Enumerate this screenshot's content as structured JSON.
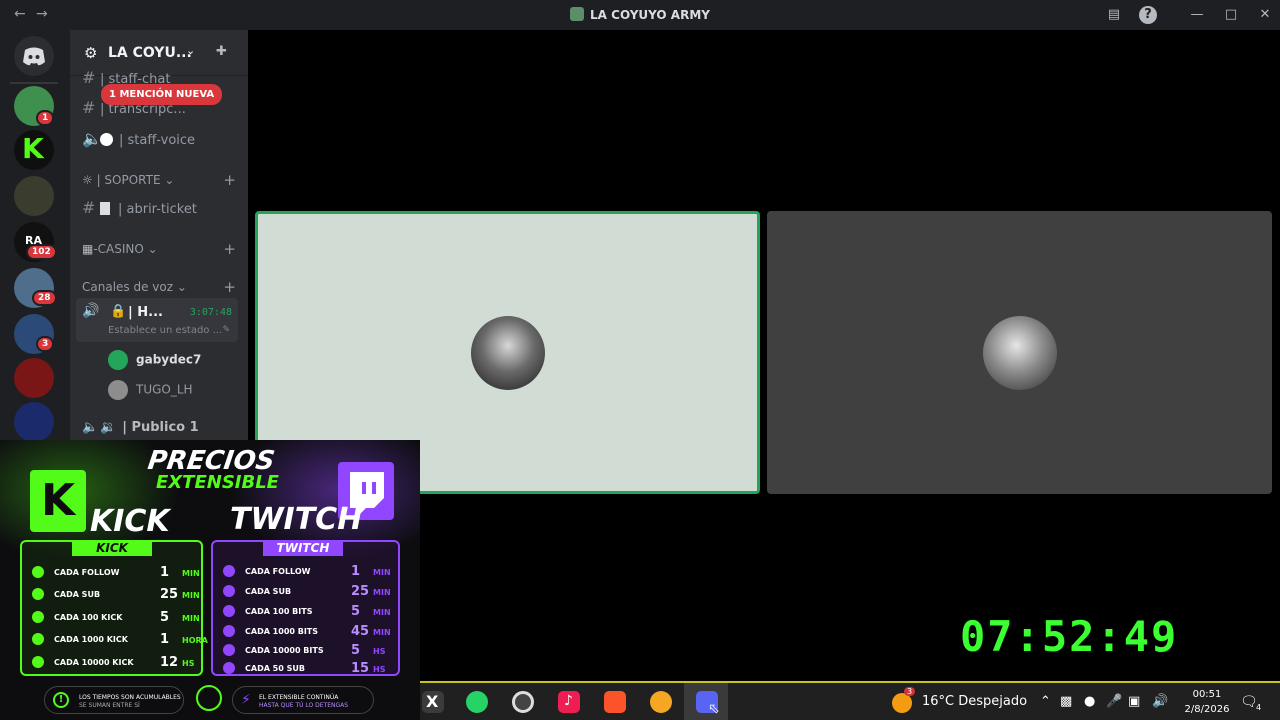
{
  "window": {
    "title": "LA COYUYO ARMY",
    "back_icon": "arrow-left-icon",
    "forward_icon": "arrow-right-icon"
  },
  "server_list": {
    "badges": [
      "1",
      "102",
      "28",
      "3"
    ]
  },
  "channel_panel": {
    "server_name": "LA COYU...",
    "mention_pill": "1 MENCIÓN NUEVA",
    "channels": {
      "staff_chat": "| staff-chat",
      "transcripts": "| transcripc...",
      "staff_voice": "| staff-voice"
    },
    "category_soporte": "| SOPORTE",
    "abrir_ticket": "| abrir-ticket",
    "category_casino": "-CASINO",
    "category_voice": "Canales de voz",
    "active_voice": {
      "name": "| H...",
      "timer": "3:07:48",
      "status": "Establece un estado ..."
    },
    "users": [
      "gabydec7",
      "TUGO_LH"
    ],
    "publico": "| Publico 1"
  },
  "clock": "07:52:49",
  "overlay": {
    "title": "PRECIOS",
    "subtitle": "EXTENSIBLE",
    "kick_big": "KICK",
    "twitch_big": "TWITCH",
    "kick_tag": "KICK",
    "twitch_tag": "TWITCH",
    "kick_rows": [
      {
        "label": "CADA FOLLOW",
        "value": "1",
        "unit": "MIN"
      },
      {
        "label": "CADA SUB",
        "value": "25",
        "unit": "MIN"
      },
      {
        "label": "CADA 100 KICK",
        "value": "5",
        "unit": "MIN"
      },
      {
        "label": "CADA 1000 KICK",
        "value": "1",
        "unit": "HORA"
      },
      {
        "label": "CADA 10000 KICK",
        "value": "12",
        "unit": "HS"
      }
    ],
    "twitch_rows": [
      {
        "label": "CADA FOLLOW",
        "value": "1",
        "unit": "MIN"
      },
      {
        "label": "CADA SUB",
        "value": "25",
        "unit": "MIN"
      },
      {
        "label": "CADA 100 BITS",
        "value": "5",
        "unit": "MIN"
      },
      {
        "label": "CADA 1000 BITS",
        "value": "45",
        "unit": "MIN"
      },
      {
        "label": "CADA 10000 BITS",
        "value": "5",
        "unit": "HS"
      },
      {
        "label": "CADA 50 SUB",
        "value": "15",
        "unit": "HS"
      }
    ],
    "note_left_1": "LOS TIEMPOS SON ACUMULABLES",
    "note_left_2": "SE SUMAN ENTRE SÍ",
    "note_right_1": "EL EXTENSIBLE CONTINÚA",
    "note_right_2": "HASTA QUE TÚ LO DETENGAS"
  },
  "taskbar": {
    "weather_badge": "3",
    "weather": "16°C  Despejado",
    "time": "00:51",
    "date": "2/8/2026",
    "notif_count": "4"
  },
  "colors": {
    "kick": "#53fc18",
    "twitch": "#9146ff",
    "clock": "#3cff32",
    "speaking": "#23a55a"
  }
}
